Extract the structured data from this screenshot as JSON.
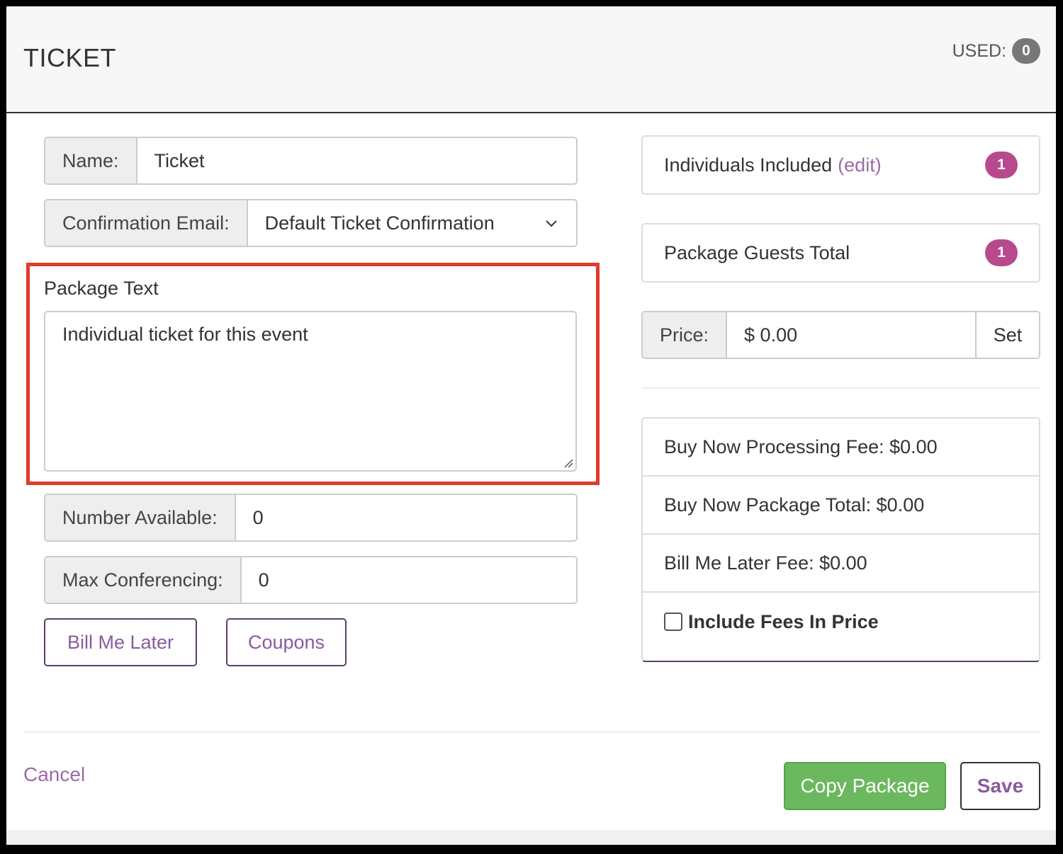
{
  "header": {
    "title": "TICKET",
    "used_label": "USED:",
    "used_count": "0"
  },
  "form": {
    "name_label": "Name:",
    "name_value": "Ticket",
    "confirmation_label": "Confirmation Email:",
    "confirmation_value": "Default Ticket Confirmation",
    "package_text_label": "Package Text",
    "package_text_value": "Individual ticket for this event",
    "number_available_label": "Number Available:",
    "number_available_value": "0",
    "max_conferencing_label": "Max Conferencing:",
    "max_conferencing_value": "0",
    "bill_me_later_button": "Bill Me Later",
    "coupons_button": "Coupons"
  },
  "sidebar": {
    "individuals_label": "Individuals Included",
    "individuals_edit": "(edit)",
    "individuals_count": "1",
    "guests_label": "Package Guests Total",
    "guests_count": "1",
    "price_label": "Price:",
    "price_value": "$ 0.00",
    "set_button": "Set",
    "fees": [
      "Buy Now Processing Fee: $0.00",
      "Buy Now Package Total: $0.00",
      "Bill Me Later Fee: $0.00"
    ],
    "include_fees_label": "Include Fees In Price"
  },
  "footer": {
    "cancel": "Cancel",
    "copy_package": "Copy Package",
    "save": "Save"
  },
  "colors": {
    "accent_purple": "#9b6aab",
    "badge_pink": "#b74a8d",
    "success_green": "#6cb85f",
    "highlight_red": "#e03c2b"
  }
}
